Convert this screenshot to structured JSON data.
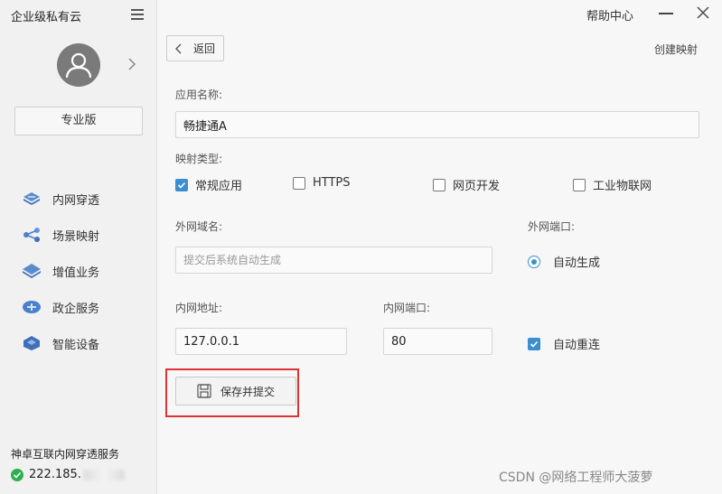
{
  "sidebar": {
    "brand": "企业级私有云",
    "plan_button": "专业版",
    "items": [
      {
        "label": "内网穿透",
        "icon": "network-penetration-icon"
      },
      {
        "label": "场景映射",
        "icon": "scene-mapping-icon"
      },
      {
        "label": "增值业务",
        "icon": "value-added-icon"
      },
      {
        "label": "政企服务",
        "icon": "gov-service-icon"
      },
      {
        "label": "智能设备",
        "icon": "smart-device-icon"
      }
    ],
    "service_title": "神卓互联内网穿透服务",
    "service_ip": "222.185."
  },
  "topbar": {
    "help": "帮助中心"
  },
  "main": {
    "back_label": "返回",
    "page_title": "创建映射",
    "app_name_label": "应用名称:",
    "app_name_value": "畅捷通A",
    "mapping_type_label": "映射类型:",
    "mapping_types": [
      {
        "label": "常规应用",
        "checked": true
      },
      {
        "label": "HTTPS",
        "checked": false
      },
      {
        "label": "网页开发",
        "checked": false
      },
      {
        "label": "工业物联网",
        "checked": false
      }
    ],
    "external_domain_label": "外网域名:",
    "external_domain_placeholder": "提交后系统自动生成",
    "external_port_label": "外网端口:",
    "external_port_option": "自动生成",
    "internal_addr_label": "内网地址:",
    "internal_addr_value": "127.0.0.1",
    "internal_port_label": "内网端口:",
    "internal_port_value": "80",
    "auto_reconnect_label": "自动重连",
    "save_label": "保存并提交"
  },
  "watermark": "CSDN @网络工程师大菠萝",
  "colors": {
    "accent": "#3b8fd0",
    "highlight": "#dd3333"
  }
}
